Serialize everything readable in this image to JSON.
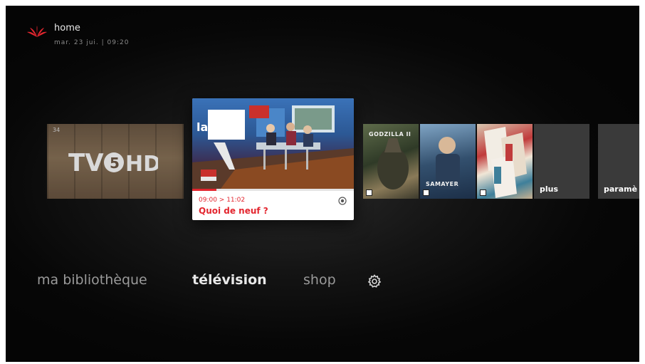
{
  "header": {
    "title": "home",
    "datetime": "mar. 23 jui. | 09:20",
    "logo_icon": "flower-logo-icon",
    "brand_color": "#e3262f"
  },
  "carousel": {
    "channel_tile": {
      "channel_number": "34",
      "channel_name": "TV5MONDE HD",
      "logo_text_left": "TV",
      "logo_text_mid": "5",
      "logo_text_right": "HD"
    },
    "live_tile": {
      "channel_logo_text": "la une",
      "time": "09:00 > 11:02",
      "title": "Quoi de neuf ?",
      "progress_fraction": 0.15,
      "record_icon": "record-icon"
    },
    "posters": [
      {
        "title": "GODZILLA II"
      },
      {
        "title": "SAMAYER"
      },
      {
        "title": ""
      }
    ],
    "more_tile": {
      "label": "plus"
    },
    "settings_tile": {
      "label": "paramè"
    }
  },
  "nav": {
    "items": [
      {
        "label": "ma bibliothèque"
      },
      {
        "label": "télévision",
        "active": true
      },
      {
        "label": "shop"
      }
    ],
    "settings_icon": "gear-icon"
  }
}
